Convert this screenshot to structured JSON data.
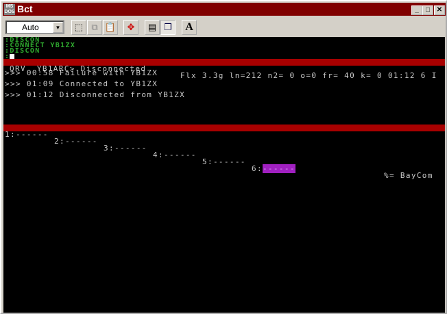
{
  "window": {
    "title": "Bct",
    "logo": "MS"
  },
  "toolbar": {
    "combo_value": "Auto",
    "buttons": [
      "select-icon",
      "copy-icon",
      "paste-icon",
      "move-icon",
      "properties-icon",
      "window-icon",
      "font-icon"
    ],
    "font_label": "A"
  },
  "terminal": {
    "commands": [
      ":DISCON",
      ":CONNECT YB1ZX",
      ":DISCON",
      ":"
    ],
    "status": {
      "left": "QRV  YB1ARC> Disconnected",
      "right": "Flx 3.3g ln=212 n2= 0 o=0 fr= 40 k= 0 01:12 6 I"
    },
    "log": [
      ">>> 00:58 Failure with YB1ZX",
      ">>> 01:09 Connected to YB1ZX",
      ">>> 01:12 Disconnected from YB1ZX"
    ],
    "channels": [
      "1:------",
      "2:------",
      "3:------",
      "4:------",
      "5:------"
    ],
    "channel6_label": "6:",
    "channel6_value": "------",
    "mode": "%= BayCom"
  },
  "colors": {
    "titlebar": "#800000",
    "status": "#a80000",
    "green": "#2faa2f",
    "active_channel": "#a020c0"
  }
}
